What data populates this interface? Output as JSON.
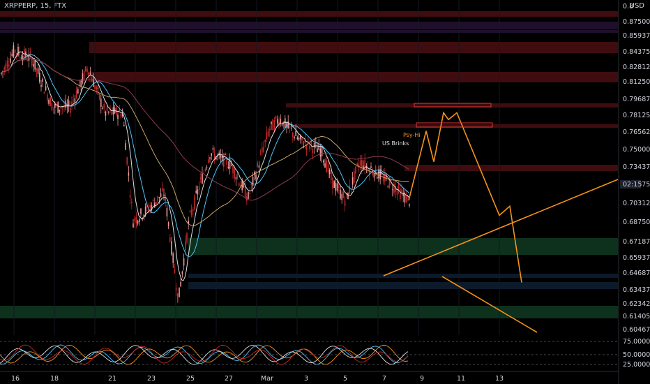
{
  "header": {
    "symbol_line": "XRPPERP, 15, FTX",
    "currency": "USD"
  },
  "colors": {
    "background": "#000000",
    "up": "#ef9a9a",
    "down": "#c62828",
    "projection": "#f7931a",
    "zone_red": "#4a0e12",
    "zone_green": "#0f3a22",
    "zone_purple": "#241233",
    "zone_blue": "#0e1f33"
  },
  "chart_data": {
    "type": "candlestick",
    "y_axis_ticks": [
      "0.875000",
      "0.859375",
      "0.843750",
      "0.828125",
      "0.812500",
      "0.796875",
      "0.781250",
      "0.765625",
      "0.750000",
      "0.734375",
      "0.718750",
      "0.703125",
      "0.687500",
      "0.671875",
      "0.659375",
      "0.646875",
      "0.634375",
      "0.623425",
      "0.614050",
      "0.604675"
    ],
    "y_axis_top_partial": "0.8",
    "price_tag": "02:15",
    "x_axis_ticks": [
      "16",
      "18",
      "21",
      "23",
      "25",
      "27",
      "Mar",
      "3",
      "5",
      "7",
      "9",
      "11",
      "13"
    ],
    "annotations": {
      "psy_hi": "Psy-Hi",
      "us_label": "US Brinks"
    },
    "oscillator": {
      "levels": [
        "75.000000",
        "50.000000",
        "25.000000"
      ]
    },
    "projection_path": [
      [
        0.718,
        0
      ],
      [
        0.779,
        1
      ],
      [
        0.752,
        2
      ],
      [
        0.795,
        3
      ],
      [
        0.789,
        4
      ],
      [
        0.795,
        5
      ],
      [
        0.705,
        6
      ],
      [
        0.713,
        7
      ],
      [
        0.646,
        8
      ]
    ],
    "trendlines": [
      {
        "from": [
          0.646,
          "a"
        ],
        "to": [
          0.718,
          "b"
        ]
      },
      {
        "from": [
          0.646,
          "c"
        ],
        "to": [
          0.605,
          "d"
        ]
      }
    ]
  }
}
